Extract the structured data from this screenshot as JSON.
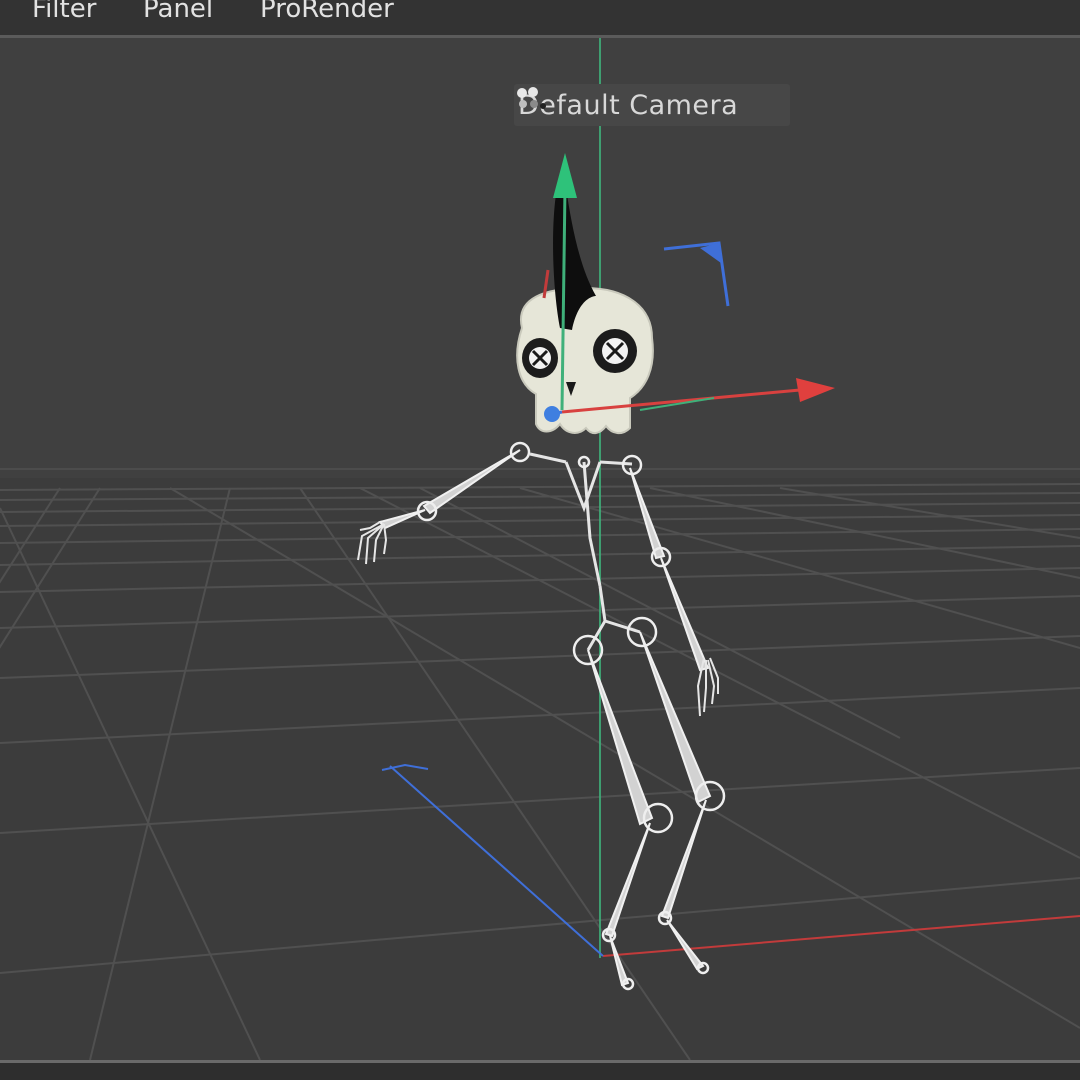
{
  "menu": {
    "items": [
      {
        "label": "Filter"
      },
      {
        "label": "Panel"
      },
      {
        "label": "ProRender"
      }
    ]
  },
  "viewport": {
    "camera_label": "Default Camera",
    "camera_icon": "camera-dots-icon",
    "background_color": "#3f3f3f",
    "grid_color": "#4e4e4e",
    "axis_colors": {
      "x": "#d8413f",
      "y": "#3fb07a",
      "z": "#3f6fd8"
    },
    "model": "skeleton-with-skull-head"
  }
}
